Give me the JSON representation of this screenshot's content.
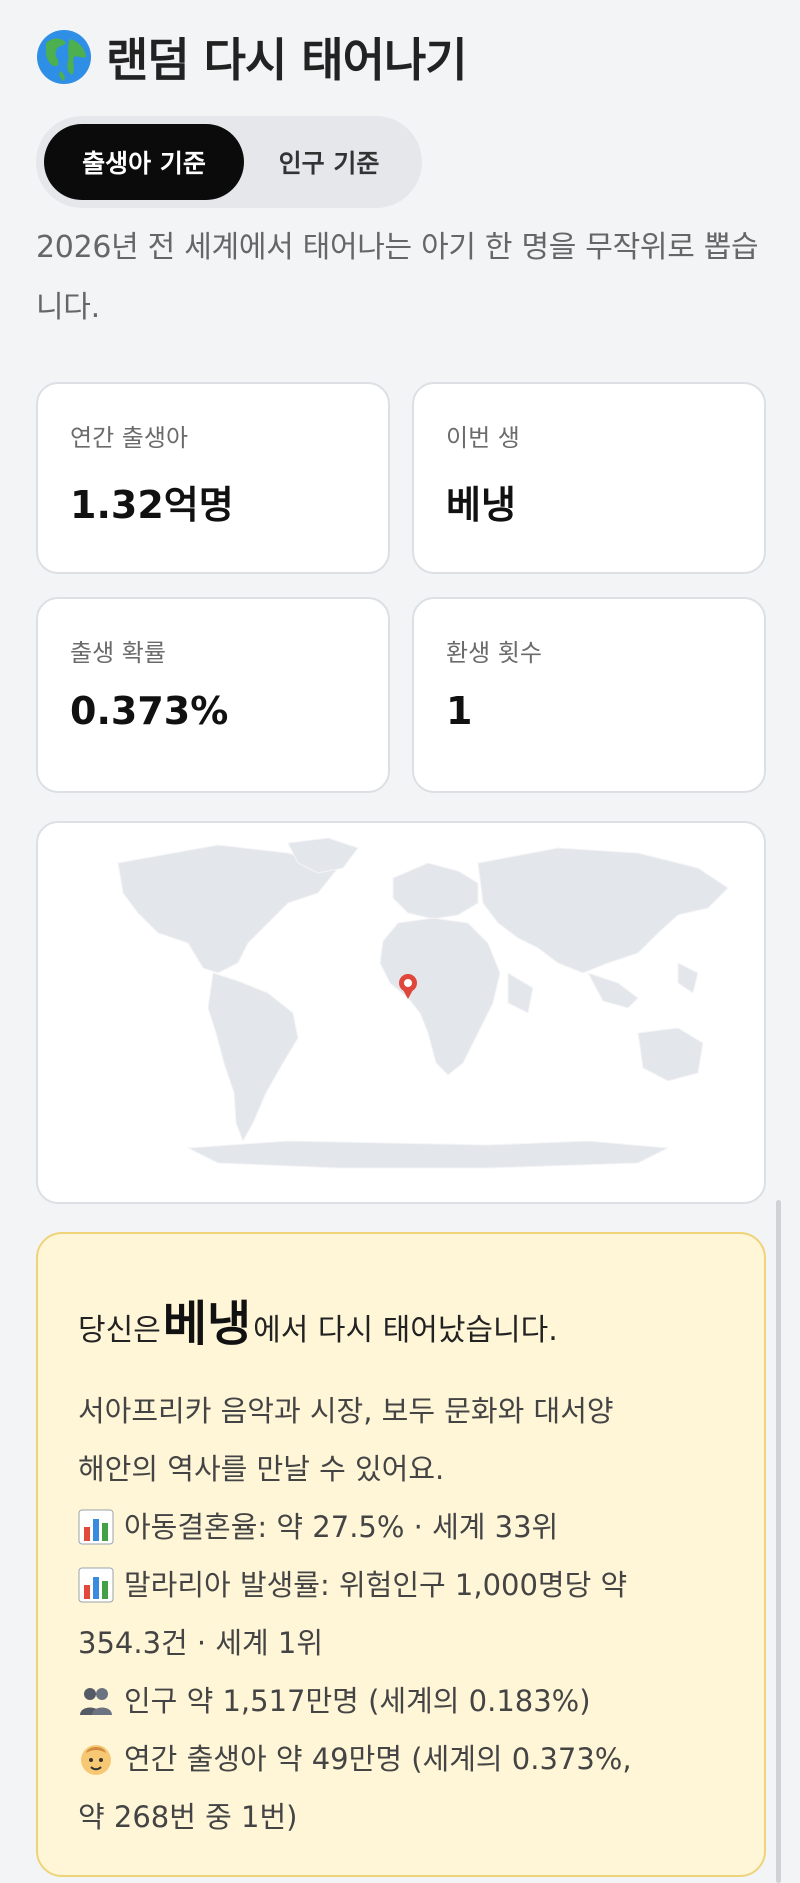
{
  "header": {
    "title": "랜덤 다시 태어나기",
    "icon": "globe-icon"
  },
  "toggle": {
    "births_label": "출생아 기준",
    "population_label": "인구 기준",
    "selected": "births"
  },
  "description": "2026년 전 세계에서 태어나는 아기 한 명을 무작위로 뽑습니다.",
  "stats": [
    {
      "label": "연간 출생아",
      "value": "1.32억명"
    },
    {
      "label": "이번 생",
      "value": "베냉"
    },
    {
      "label": "출생 확률",
      "value": "0.373%"
    },
    {
      "label": "환생 횟수",
      "value": "1"
    }
  ],
  "map": {
    "marker_country": "베냉",
    "marker_icon": "location-pin-icon"
  },
  "result": {
    "prefix": "당신은 ",
    "country": "베냉",
    "suffix": "에서 다시 태어났습니다.",
    "intro_line1": "서아프리카 음악과 시장, 보두 문화와 대서양",
    "intro_line2": "해안의 역사를 만날 수 있어요.",
    "facts": [
      {
        "icon": "bar-chart-icon",
        "text": "아동결혼율: 약 27.5% · 세계 33위"
      },
      {
        "icon": "bar-chart-icon",
        "text": "말라리아 발생률: 위험인구 1,000명당 약",
        "cont": "354.3건 · 세계 1위"
      },
      {
        "icon": "people-icon",
        "text": "인구 약 1,517만명 (세계의 0.183%)"
      },
      {
        "icon": "baby-icon",
        "text": "연간 출생아 약 49만명 (세계의 0.373%,",
        "cont": "약 268번 중 1번)"
      }
    ]
  },
  "colors": {
    "background": "#f3f4f6",
    "active_toggle": "#0b0b0b",
    "result_bg": "#fff6d8",
    "result_border": "#efd37a",
    "marker": "#e0473c"
  }
}
